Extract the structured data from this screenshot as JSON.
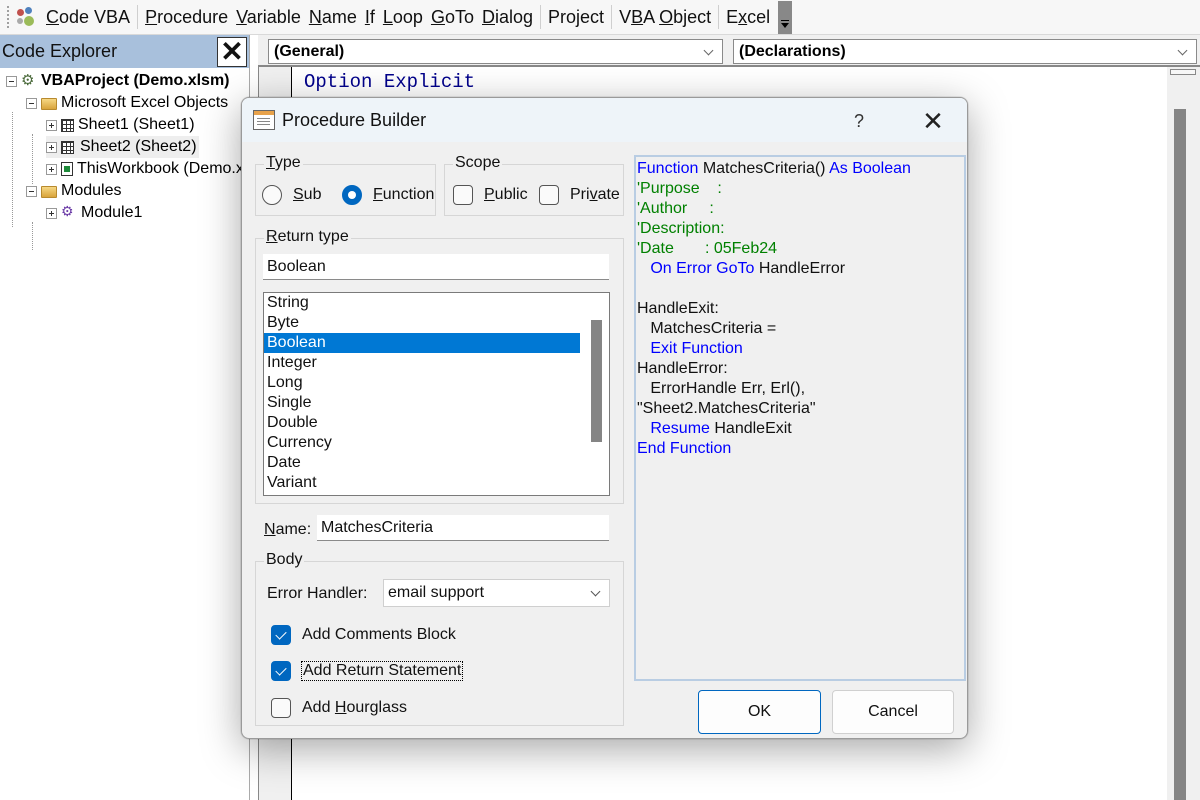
{
  "toolbar": {
    "icon": "codevba-icon",
    "items": [
      {
        "label": "Code VBA",
        "accel": "C",
        "rest": "ode VBA"
      },
      {
        "label": "Procedure",
        "accel": "P",
        "rest": "rocedure"
      },
      {
        "label": "Variable",
        "accel": "V",
        "rest": "ariable"
      },
      {
        "label": "Name",
        "accel": "N",
        "rest": "ame"
      },
      {
        "label": "If",
        "accel": "I",
        "rest": "f"
      },
      {
        "label": "Loop",
        "accel": "L",
        "rest": "oop"
      },
      {
        "label": "GoTo",
        "accel": "G",
        "rest": "oTo"
      },
      {
        "label": "Dialog",
        "accel": "D",
        "rest": "ialog"
      },
      {
        "label": "Project"
      },
      {
        "label": "VBA",
        "pre": "V",
        "accel": "B",
        "rest": "A"
      },
      {
        "label": "Object",
        "accel": "O",
        "rest": "bject"
      },
      {
        "label": "Excel",
        "pre": "E",
        "accel": "x",
        "rest": "cel"
      }
    ],
    "overflow_icon": "toolbar-overflow-icon"
  },
  "explorer": {
    "title": "Code Explorer",
    "close_label": "✕",
    "tree": [
      {
        "label": "VBAProject (Demo.xlsm)",
        "icon": "vbaproject-icon",
        "level": 0,
        "expanded": true,
        "bold": true
      },
      {
        "label": "Microsoft Excel Objects",
        "icon": "folder-icon",
        "level": 1,
        "expanded": true
      },
      {
        "label": "Sheet1 (Sheet1)",
        "icon": "worksheet-icon",
        "level": 2,
        "expanded": false
      },
      {
        "label": "Sheet2 (Sheet2)",
        "icon": "worksheet-icon",
        "level": 2,
        "expanded": false,
        "selected": true
      },
      {
        "label": "ThisWorkbook (Demo.xlsm)",
        "icon": "workbook-icon",
        "level": 2,
        "expanded": false
      },
      {
        "label": "Modules",
        "icon": "folder-icon",
        "level": 1,
        "expanded": true
      },
      {
        "label": "Module1",
        "icon": "module-icon",
        "level": 2,
        "expanded": false
      }
    ]
  },
  "code_window": {
    "object_combo": "(General)",
    "procedure_combo": "(Declarations)",
    "code_lines": [
      "Option Explicit"
    ]
  },
  "dialog": {
    "title": "Procedure Builder",
    "help_label": "?",
    "close_label": "✕",
    "type_group": {
      "legend_accel": "T",
      "legend_rest": "ype",
      "options": [
        {
          "accel": "S",
          "rest": "ub",
          "label": "Sub",
          "selected": false
        },
        {
          "accel": "F",
          "rest": "unction",
          "label": "Function",
          "selected": true
        }
      ]
    },
    "scope_group": {
      "legend": "Scope",
      "options": [
        {
          "pre": "",
          "accel": "P",
          "rest": "ublic",
          "label": "Public",
          "checked": false
        },
        {
          "pre": "Pri",
          "accel": "v",
          "rest": "ate",
          "label": "Private",
          "checked": false
        }
      ]
    },
    "return_type": {
      "legend_accel": "R",
      "legend_rest": "eturn type",
      "value": "Boolean",
      "options": [
        "String",
        "Byte",
        "Boolean",
        "Integer",
        "Long",
        "Single",
        "Double",
        "Currency",
        "Date",
        "Variant"
      ],
      "selected": "Boolean"
    },
    "name": {
      "label_accel": "N",
      "label_rest": "ame:",
      "value": "MatchesCriteria"
    },
    "body": {
      "legend": "Body",
      "error_handler_label": "Error Handler:",
      "error_handler_value": "email support",
      "checkboxes": [
        {
          "label": "Add Comments Block",
          "pre": "Add Comments Block",
          "accel": "",
          "rest": "",
          "checked": true
        },
        {
          "label": "Add Return Statement",
          "pre": "Add Return Statement",
          "accel": "",
          "rest": "",
          "checked": true,
          "focused": true
        },
        {
          "label": "Add Hourglass",
          "pre": "Add ",
          "accel": "H",
          "rest": "ourglass",
          "checked": false
        }
      ]
    },
    "preview": [
      [
        {
          "t": "Function",
          "c": "kw"
        },
        {
          "t": " MatchesCriteria() "
        },
        {
          "t": "As Boolean",
          "c": "kw"
        }
      ],
      [
        {
          "t": "'Purpose    :",
          "c": "cm"
        }
      ],
      [
        {
          "t": "'Author     :",
          "c": "cm"
        }
      ],
      [
        {
          "t": "'Description:",
          "c": "cm"
        }
      ],
      [
        {
          "t": "'Date       : 05Feb24",
          "c": "cm"
        }
      ],
      [
        {
          "t": "   "
        },
        {
          "t": "On Error GoTo",
          "c": "kw"
        },
        {
          "t": " HandleError"
        }
      ],
      [
        {
          "t": ""
        }
      ],
      [
        {
          "t": "HandleExit:"
        }
      ],
      [
        {
          "t": "   MatchesCriteria ="
        }
      ],
      [
        {
          "t": "   "
        },
        {
          "t": "Exit Function",
          "c": "kw"
        }
      ],
      [
        {
          "t": "HandleError:"
        }
      ],
      [
        {
          "t": "   ErrorHandle Err, Erl(),"
        }
      ],
      [
        {
          "t": "\"Sheet2.MatchesCriteria\""
        }
      ],
      [
        {
          "t": "   "
        },
        {
          "t": "Resume",
          "c": "kw"
        },
        {
          "t": " HandleExit"
        }
      ],
      [
        {
          "t": "End Function",
          "c": "kw"
        }
      ]
    ],
    "ok_label": "OK",
    "cancel_label": "Cancel"
  }
}
